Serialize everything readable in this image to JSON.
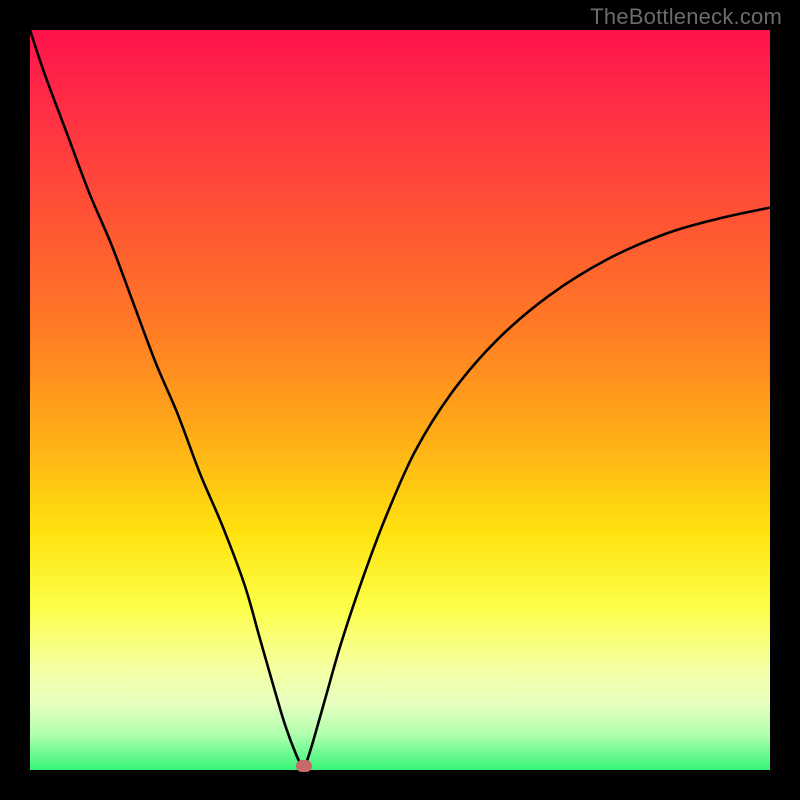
{
  "watermark": "TheBottleneck.com",
  "colors": {
    "background": "#000000",
    "watermark": "#6b6b6b",
    "curve": "#000000",
    "marker": "#c76a6a",
    "gradient_stops": [
      {
        "pct": 0,
        "color": "#ff124c"
      },
      {
        "pct": 10,
        "color": "#ff2d46"
      },
      {
        "pct": 25,
        "color": "#ff5234"
      },
      {
        "pct": 40,
        "color": "#ff7a25"
      },
      {
        "pct": 55,
        "color": "#ffad17"
      },
      {
        "pct": 68,
        "color": "#ffe30e"
      },
      {
        "pct": 78,
        "color": "#fcff48"
      },
      {
        "pct": 86,
        "color": "#f6ffa0"
      },
      {
        "pct": 91,
        "color": "#e7ffc0"
      },
      {
        "pct": 95,
        "color": "#b3ffb0"
      },
      {
        "pct": 100,
        "color": "#38f47a"
      }
    ]
  },
  "chart_data": {
    "type": "line",
    "title": "",
    "xlabel": "",
    "ylabel": "",
    "xlim": [
      0,
      100
    ],
    "ylim": [
      0,
      100
    ],
    "grid": false,
    "legend": null,
    "note": "V-shaped curve on a red-to-green vertical heat gradient. Left branch starts top-left and descends to the minimum; right branch rises with diminishing slope. Axes are unlabeled; values below are estimated from pixel positions as percentages of the plot area.",
    "series": [
      {
        "name": "left-branch",
        "x": [
          0,
          2,
          5,
          8,
          11,
          14,
          17,
          20,
          23,
          26,
          29,
          31,
          33,
          34.5,
          36,
          37
        ],
        "values": [
          100,
          94,
          86,
          78,
          71,
          63,
          55,
          48,
          40,
          33,
          25,
          18,
          11,
          6,
          2,
          0
        ]
      },
      {
        "name": "right-branch",
        "x": [
          37,
          38,
          40,
          42,
          45,
          48,
          52,
          57,
          63,
          70,
          78,
          86,
          93,
          100
        ],
        "values": [
          0,
          3,
          10,
          17,
          26,
          34,
          43,
          51,
          58,
          64,
          69,
          72.5,
          74.5,
          76
        ]
      }
    ],
    "points": [
      {
        "name": "marker",
        "x": 37,
        "y": 0.5
      }
    ]
  }
}
